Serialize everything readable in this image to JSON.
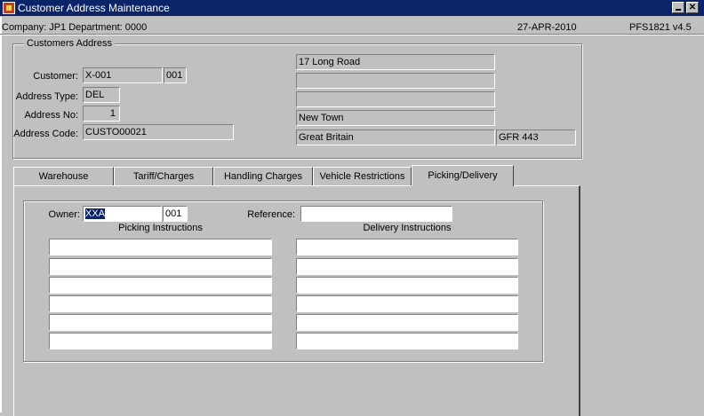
{
  "window": {
    "title": "Customer Address Maintenance",
    "minimize_glyph": "",
    "close_glyph": "✕"
  },
  "status": {
    "company": "Company:  JP1   Department:  0000",
    "date": "27-APR-2010",
    "form_id": "PFS1821  v4.5"
  },
  "customers_address": {
    "legend": "Customers Address",
    "customer_label": "Customer:",
    "customer_code": "X-001",
    "customer_suffix": "001",
    "address_type_label": "Address Type:",
    "address_type": "DEL",
    "address_no_label": "Address No:",
    "address_no": "1",
    "address_code_label": "Address Code:",
    "address_code": "CUSTO00021",
    "address_lines": [
      "17 Long Road",
      "",
      "",
      "New Town",
      "Great Britain"
    ],
    "postcode": "GFR 443"
  },
  "tabs": [
    {
      "label": "Warehouse"
    },
    {
      "label": "Tariff/Charges"
    },
    {
      "label": "Handling Charges"
    },
    {
      "label": "Vehicle  Restrictions"
    },
    {
      "label": "Picking/Delivery"
    }
  ],
  "active_tab": "Picking/Delivery",
  "picking_delivery": {
    "owner_label": "Owner:",
    "owner": "XXA",
    "owner_suffix": "001",
    "reference_label": "Reference:",
    "reference": "",
    "picking_header": "Picking Instructions",
    "delivery_header": "Delivery Instructions",
    "picking_lines": [
      "",
      "",
      "",
      "",
      "",
      ""
    ],
    "delivery_lines": [
      "",
      "",
      "",
      "",
      "",
      ""
    ]
  },
  "colors": {
    "titlebar": "#0a246a",
    "face": "#c0c0c0",
    "selection": "#0a246a"
  }
}
